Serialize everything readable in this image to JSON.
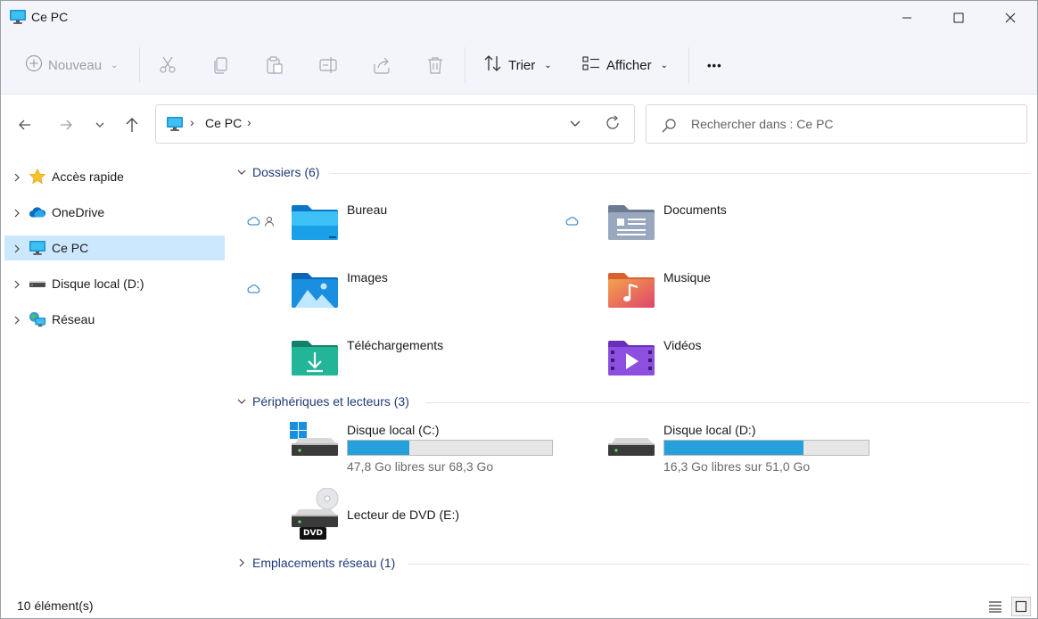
{
  "window": {
    "title": "Ce PC"
  },
  "commandbar": {
    "new_label": "Nouveau",
    "sort_label": "Trier",
    "view_label": "Afficher",
    "more_label": "•••"
  },
  "address": {
    "location": "Ce PC",
    "search_placeholder": "Rechercher dans : Ce PC"
  },
  "sidebar": {
    "items": [
      {
        "label": "Accès rapide",
        "icon": "star-icon"
      },
      {
        "label": "OneDrive",
        "icon": "cloud-icon"
      },
      {
        "label": "Ce PC",
        "icon": "computer-icon",
        "selected": true
      },
      {
        "label": "Disque local (D:)",
        "icon": "drive-icon"
      },
      {
        "label": "Réseau",
        "icon": "network-icon"
      }
    ]
  },
  "groups": {
    "folders": {
      "label": "Dossiers (6)"
    },
    "devices": {
      "label": "Périphériques et lecteurs (3)"
    },
    "network": {
      "label": "Emplacements réseau (1)"
    }
  },
  "folders": [
    {
      "label": "Bureau",
      "icon": "desktop-folder-icon",
      "badges": [
        "cloud-icon",
        "person-icon"
      ]
    },
    {
      "label": "Documents",
      "icon": "documents-folder-icon",
      "badges": [
        "cloud-icon"
      ]
    },
    {
      "label": "Images",
      "icon": "pictures-folder-icon",
      "badges": [
        "cloud-icon"
      ]
    },
    {
      "label": "Musique",
      "icon": "music-folder-icon",
      "badges": []
    },
    {
      "label": "Téléchargements",
      "icon": "downloads-folder-icon",
      "badges": []
    },
    {
      "label": "Vidéos",
      "icon": "videos-folder-icon",
      "badges": []
    }
  ],
  "drives": [
    {
      "label": "Disque local (C:)",
      "free_text": "47,8 Go libres sur 68,3 Go",
      "used_fraction": 0.3
    },
    {
      "label": "Disque local (D:)",
      "free_text": "16,3 Go libres sur 51,0 Go",
      "used_fraction": 0.68
    },
    {
      "label": "Lecteur de DVD (E:)",
      "badge": "DVD"
    }
  ],
  "status": {
    "count_text": "10 élément(s)"
  },
  "colors": {
    "accent": "#26a0da",
    "group_header": "#1f3a78",
    "selection": "#cce8ff"
  }
}
